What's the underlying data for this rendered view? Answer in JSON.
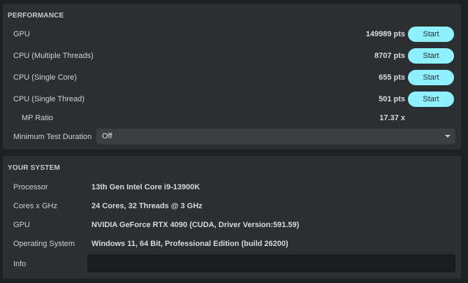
{
  "performance": {
    "title": "PERFORMANCE",
    "rows": [
      {
        "label": "GPU",
        "score": "149989 pts",
        "button": "Start"
      },
      {
        "label": "CPU (Multiple Threads)",
        "score": "8707 pts",
        "button": "Start"
      },
      {
        "label": "CPU (Single Core)",
        "score": "655 pts",
        "button": "Start"
      },
      {
        "label": "CPU (Single Thread)",
        "score": "501 pts",
        "button": "Start"
      }
    ],
    "mp_ratio": {
      "label": "MP Ratio",
      "value": "17.37 x"
    },
    "min_duration": {
      "label": "Minimum Test Duration",
      "value": "Off",
      "icon": "chevron-down-icon"
    }
  },
  "system": {
    "title": "YOUR SYSTEM",
    "rows": [
      {
        "label": "Processor",
        "value": "13th Gen Intel Core i9-13900K"
      },
      {
        "label": "Cores x GHz",
        "value": "24 Cores, 32 Threads @ 3 GHz"
      },
      {
        "label": "GPU",
        "value": "NVIDIA GeForce RTX 4090 (CUDA, Driver Version:591.59)"
      },
      {
        "label": "Operating System",
        "value": "Windows 11, 64 Bit, Professional Edition (build 26200)"
      }
    ],
    "info": {
      "label": "Info",
      "value": ""
    }
  },
  "colors": {
    "accent": "#8ff0ff",
    "panel": "#2b2f30",
    "background": "#1e2122"
  }
}
